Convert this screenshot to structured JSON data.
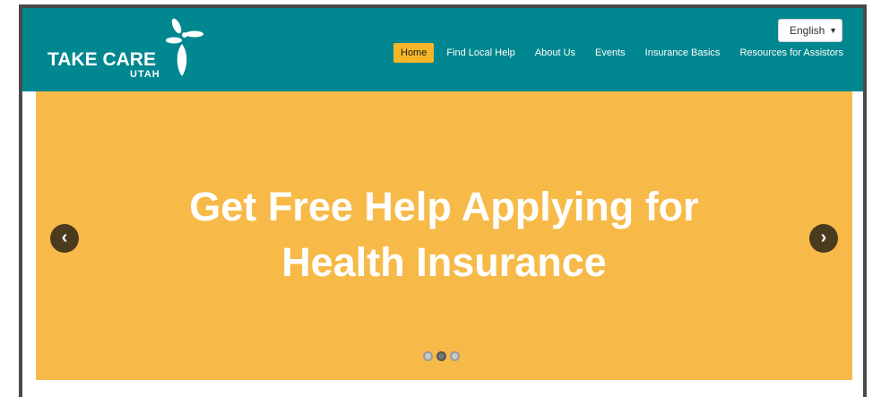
{
  "brand": {
    "logo_main": "TAKE CARE",
    "logo_sub": "UTAH"
  },
  "language": {
    "selected": "English",
    "caret_icon": "triangle-down"
  },
  "nav": {
    "items": [
      {
        "label": "Home",
        "active": true
      },
      {
        "label": "Find Local Help",
        "active": false
      },
      {
        "label": "About Us",
        "active": false
      },
      {
        "label": "Events",
        "active": false
      },
      {
        "label": "Insurance Basics",
        "active": false
      },
      {
        "label": "Resources for Assistors",
        "active": false
      }
    ]
  },
  "hero": {
    "title_line1": "Get Free Help Applying for",
    "title_line2": "Health Insurance",
    "prev_icon": "chevron-left",
    "next_icon": "chevron-right",
    "slides_total": 3,
    "active_slide": 2
  },
  "colors": {
    "header": "#00878f",
    "hero": "#f7ba48",
    "nav_active": "#f5b627",
    "arrow": "#4b3b1e"
  }
}
